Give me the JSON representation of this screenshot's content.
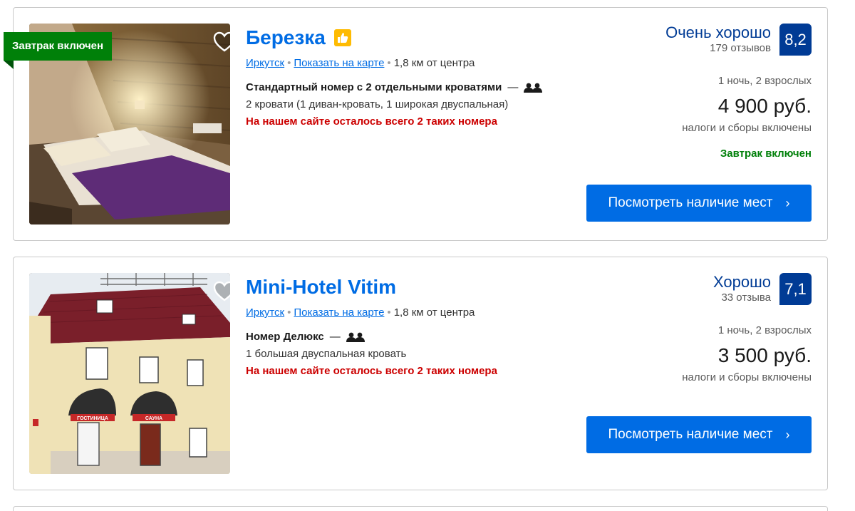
{
  "hotels": [
    {
      "name": "Березка",
      "badge": "Завтрак включен",
      "city": "Иркутск",
      "map_link": "Показать на карте",
      "distance": "1,8 км от центра",
      "room_title": "Стандартный номер с 2 отдельными кроватями",
      "room_desc": "2 кровати (1 диван-кровать, 1 широкая двуспальная)",
      "scarcity": "На нашем сайте осталось всего 2 таких номера",
      "review_word": "Очень хорошо",
      "review_count": "179 отзывов",
      "score": "8,2",
      "stay": "1 ночь, 2 взрослых",
      "price": "4 900 руб.",
      "taxes": "налоги и сборы включены",
      "breakfast": "Завтрак включен",
      "cta": "Посмотреть наличие мест",
      "dash": "—",
      "dot": "•",
      "chevron": "›"
    },
    {
      "name": "Mini-Hotel Vitim",
      "city": "Иркутск",
      "map_link": "Показать на карте",
      "distance": "1,8 км от центра",
      "room_title": "Номер Делюкс",
      "room_desc": "1 большая двуспальная кровать",
      "scarcity": "На нашем сайте осталось всего 2 таких номера",
      "review_word": "Хорошо",
      "review_count": "33 отзыва",
      "score": "7,1",
      "stay": "1 ночь, 2 взрослых",
      "price": "3 500 руб.",
      "taxes": "налоги и сборы включены",
      "cta": "Посмотреть наличие мест",
      "dash": "—",
      "dot": "•",
      "chevron": "›",
      "sign_left": "ГОСТИНИЦА",
      "sign_right": "САУНА"
    }
  ],
  "icons": {
    "favorite": "heart-icon",
    "preferred": "thumbs-up-icon",
    "persons": "two-persons-icon",
    "chevron": "chevron-right-icon"
  },
  "colors": {
    "link_blue": "#006ce4",
    "score_navy": "#003b95",
    "badge_green": "#008009",
    "scarcity_red": "#cc0000",
    "preferred_yellow": "#febb02"
  }
}
